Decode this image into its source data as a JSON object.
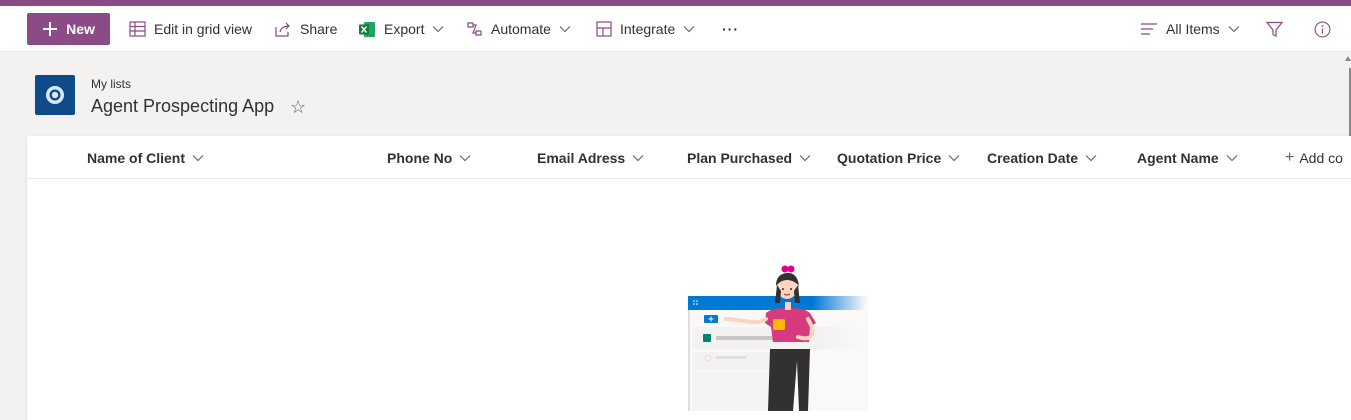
{
  "colors": {
    "brand": "#8a4b86",
    "site_logo": "#0f4a8a",
    "accent_blue": "#0078d4"
  },
  "commandbar": {
    "new_label": "New",
    "edit_grid_label": "Edit in grid view",
    "share_label": "Share",
    "export_label": "Export",
    "automate_label": "Automate",
    "integrate_label": "Integrate",
    "more_label": "···",
    "view_label": "All Items",
    "icons": [
      "plus-icon",
      "grid-icon",
      "share-icon",
      "excel-icon",
      "automate-icon",
      "integrate-icon",
      "more-icon",
      "view-lines-icon",
      "filter-icon",
      "info-icon"
    ]
  },
  "site": {
    "breadcrumb": "My lists",
    "title": "Agent Prospecting App",
    "favorite_icon": "☆"
  },
  "list": {
    "columns": [
      {
        "label": "Name of Client"
      },
      {
        "label": "Phone No"
      },
      {
        "label": "Email Adress"
      },
      {
        "label": "Plan Purchased"
      },
      {
        "label": "Quotation Price"
      },
      {
        "label": "Creation Date"
      },
      {
        "label": "Agent Name"
      }
    ],
    "add_column_label": "Add co",
    "add_column_icon": "+"
  }
}
